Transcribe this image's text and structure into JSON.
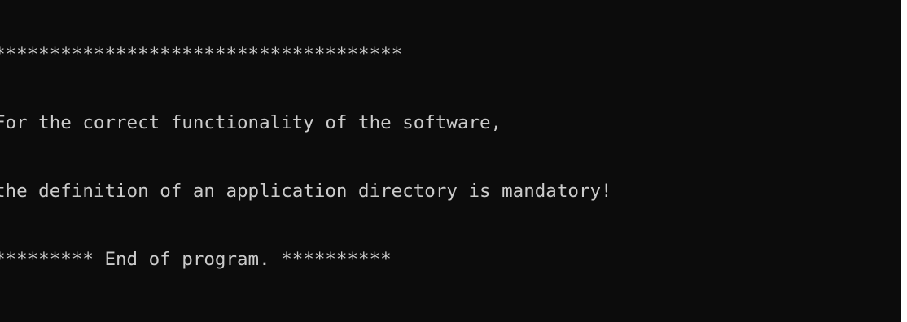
{
  "console": {
    "lines": [
      "*************************************",
      "For the correct functionality of the software,",
      "the definition of an application directory is mandatory!",
      "********* End of program. **********"
    ]
  }
}
